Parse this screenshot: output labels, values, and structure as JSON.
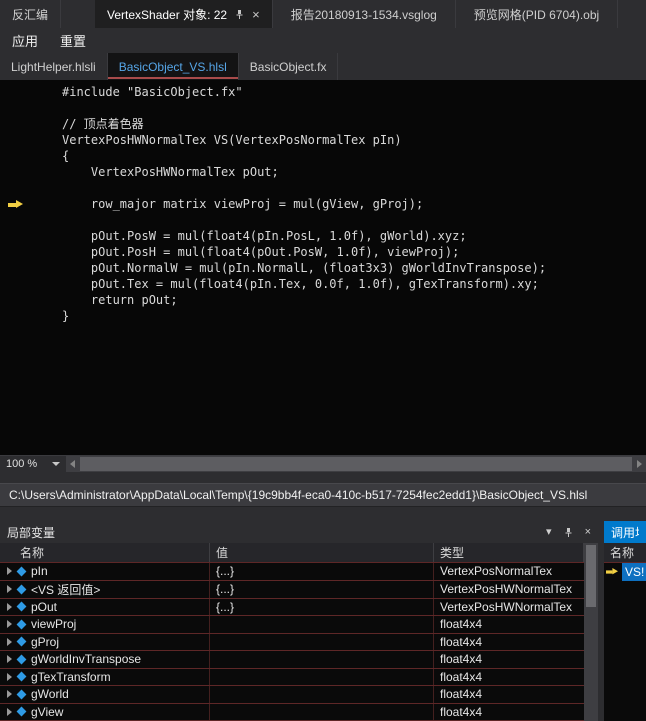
{
  "top_tabs": {
    "disassembly": "反汇编",
    "vertexshader": "VertexShader 对象: 22",
    "vsglog": "报告20180913-1534.vsglog",
    "mesh_preview": "预览网格(PID 6704).obj"
  },
  "menubar": {
    "apply": "应用",
    "reset": "重置"
  },
  "file_tabs": [
    {
      "label": "LightHelper.hlsli"
    },
    {
      "label": "BasicObject_VS.hlsl"
    },
    {
      "label": "BasicObject.fx"
    }
  ],
  "editor": {
    "lines": [
      "#include \"BasicObject.fx\"",
      "",
      "// 顶点着色器",
      "VertexPosHWNormalTex VS(VertexPosNormalTex pIn)",
      "{",
      "    VertexPosHWNormalTex pOut;",
      "",
      "    row_major matrix viewProj = mul(gView, gProj);",
      "",
      "    pOut.PosW = mul(float4(pIn.PosL, 1.0f), gWorld).xyz;",
      "    pOut.PosH = mul(float4(pOut.PosW, 1.0f), viewProj);",
      "    pOut.NormalW = mul(pIn.NormalL, (float3x3) gWorldInvTranspose);",
      "    pOut.Tex = mul(float4(pIn.Tex, 0.0f, 1.0f), gTexTransform).xy;",
      "    return pOut;",
      "}"
    ],
    "current_line": 7,
    "zoom": "100 %"
  },
  "path_bar": "C:\\Users\\Administrator\\AppData\\Local\\Temp\\{19c9bb4f-eca0-410c-b517-7254fec2edd1}\\BasicObject_VS.hlsl",
  "locals": {
    "title": "局部变量",
    "columns": {
      "name": "名称",
      "value": "值",
      "type": "类型"
    },
    "rows": [
      {
        "name": "pIn",
        "value": "{...}",
        "type": "VertexPosNormalTex"
      },
      {
        "name": "<VS 返回值>",
        "value": "{...}",
        "type": "VertexPosHWNormalTex"
      },
      {
        "name": "pOut",
        "value": "{...}",
        "type": "VertexPosHWNormalTex"
      },
      {
        "name": "viewProj",
        "value": "",
        "type": "float4x4"
      },
      {
        "name": "gProj",
        "value": "",
        "type": "float4x4"
      },
      {
        "name": "gWorldInvTranspose",
        "value": "",
        "type": "float4x4"
      },
      {
        "name": "gTexTransform",
        "value": "",
        "type": "float4x4"
      },
      {
        "name": "gWorld",
        "value": "",
        "type": "float4x4"
      },
      {
        "name": "gView",
        "value": "",
        "type": "float4x4"
      }
    ]
  },
  "callstack": {
    "title": "调用堆",
    "name_column": "名称",
    "top_frame": "VS!"
  },
  "colors": {
    "accent_blue": "#007acc",
    "active_tab_text": "#56a6e8",
    "tab_underline_red": "#a84b4b",
    "exec_arrow_yellow": "#f2cf43",
    "grid_line_red": "#5e2727",
    "selected_frame_blue": "#0e70c0",
    "field_icon_blue": "#2e9be6"
  }
}
